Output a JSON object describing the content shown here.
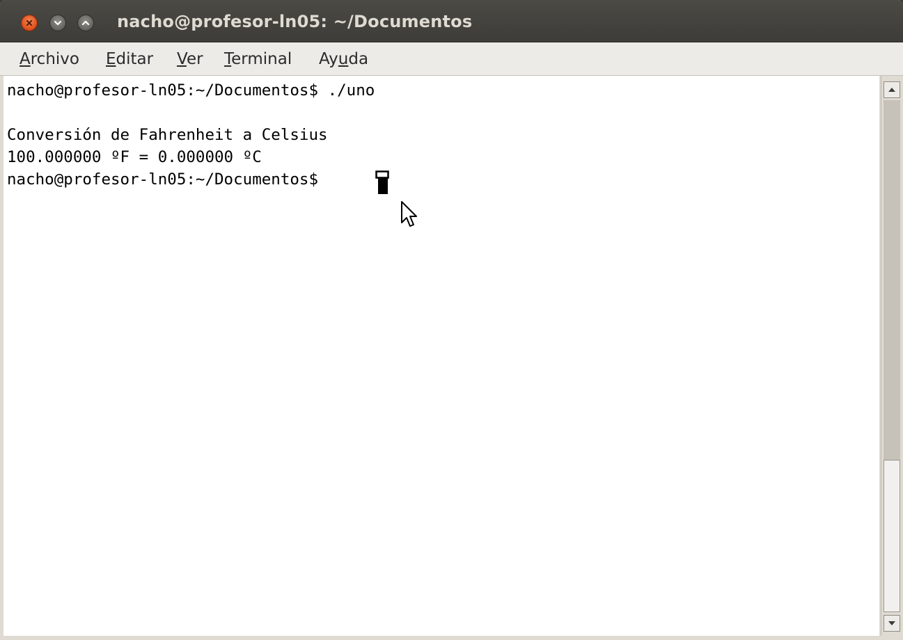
{
  "window": {
    "title": "nacho@profesor-ln05: ~/Documentos"
  },
  "menu": [
    {
      "mnemonic": "A",
      "rest": "rchivo"
    },
    {
      "mnemonic": "E",
      "rest": "ditar"
    },
    {
      "mnemonic": "V",
      "rest": "er"
    },
    {
      "mnemonic": "T",
      "rest": "erminal"
    },
    {
      "before": "Ay",
      "mnemonic": "u",
      "rest": "da"
    }
  ],
  "terminal": {
    "lines": [
      "nacho@profesor-ln05:~/Documentos$ ./uno",
      "",
      "Conversión de Fahrenheit a Celsius",
      "100.000000 ºF = 0.000000 ºC",
      "nacho@profesor-ln05:~/Documentos$ "
    ]
  },
  "scrollbar": {
    "position": 1.0,
    "visible_fraction": 0.3
  },
  "colors": {
    "titlebar": "#3c3b37",
    "close_button": "#e0541f",
    "menubar": "#edebe7",
    "terminal_bg": "#ffffff",
    "terminal_fg": "#000000"
  },
  "icons": [
    "close-icon",
    "minimize-icon",
    "maximize-icon",
    "mouse-pointer-icon",
    "arrow-up-icon",
    "arrow-down-icon"
  ]
}
